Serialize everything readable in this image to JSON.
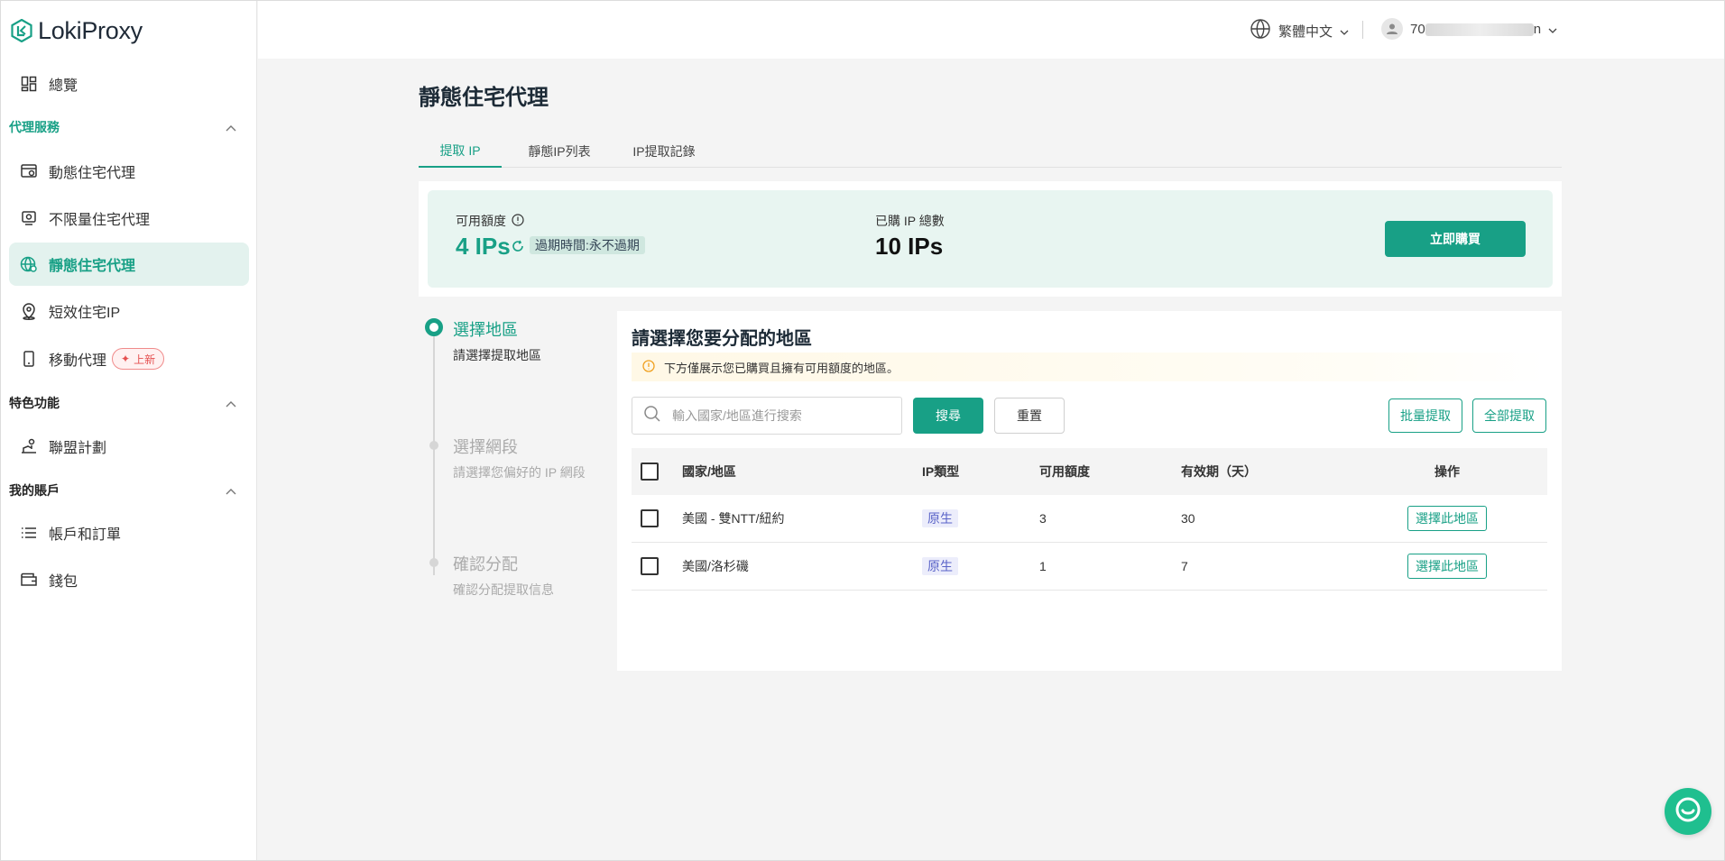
{
  "app": {
    "logo_text": "LokiProxy"
  },
  "header": {
    "language": "繁體中文",
    "user_prefix": "70",
    "user_suffix": "n"
  },
  "sidebar": {
    "overview": "總覽",
    "group_proxy": "代理服務",
    "proxy_items": [
      {
        "label": "動態住宅代理",
        "icon": "dynamic-proxy-icon"
      },
      {
        "label": "不限量住宅代理",
        "icon": "unlimited-proxy-icon"
      },
      {
        "label": "靜態住宅代理",
        "icon": "static-proxy-icon",
        "active": true
      },
      {
        "label": "短效住宅IP",
        "icon": "short-ip-icon"
      },
      {
        "label": "移動代理",
        "icon": "mobile-icon",
        "badge": "上新"
      }
    ],
    "group_features": "特色功能",
    "feature_items": [
      {
        "label": "聯盟計劃",
        "icon": "affiliate-icon"
      }
    ],
    "group_account": "我的賬戶",
    "account_items": [
      {
        "label": "帳戶和訂單",
        "icon": "list-icon"
      },
      {
        "label": "錢包",
        "icon": "wallet-icon"
      }
    ]
  },
  "main": {
    "title": "靜態住宅代理",
    "tabs": [
      "提取 IP",
      "靜態IP列表",
      "IP提取記錄"
    ],
    "quota": {
      "available_label": "可用額度",
      "available_value": "4 IPs",
      "expire_label": "過期時間:",
      "expire_value": "永不過期",
      "purchased_label": "已購 IP 總數",
      "purchased_value": "10 IPs",
      "buy_button": "立即購買"
    },
    "steps": [
      {
        "title": "選擇地區",
        "sub": "請選擇提取地區"
      },
      {
        "title": "選擇網段",
        "sub": "請選擇您偏好的 IP 網段"
      },
      {
        "title": "確認分配",
        "sub": "確認分配提取信息"
      }
    ],
    "region_panel": {
      "title": "請選擇您要分配的地區",
      "notice": "下方僅展示您已購買且擁有可用額度的地區。",
      "search_placeholder": "輸入國家/地區進行搜索",
      "search_button": "搜尋",
      "reset_button": "重置",
      "batch_button": "批量提取",
      "all_button": "全部提取",
      "columns": [
        "國家/地區",
        "IP類型",
        "可用額度",
        "有效期（天）",
        "操作"
      ],
      "rows": [
        {
          "region": "美國 - 雙NTT/紐約",
          "type": "原生",
          "quota": "3",
          "validity": "30",
          "action": "選擇此地區"
        },
        {
          "region": "美國/洛杉磯",
          "type": "原生",
          "quota": "1",
          "validity": "7",
          "action": "選擇此地區"
        }
      ]
    }
  },
  "colors": {
    "accent": "#18a086",
    "accent_light": "#e3f2ee",
    "quota_bg": "#e8f5f1",
    "notice_bg": "#fff8e6",
    "badge": "#e55050"
  }
}
